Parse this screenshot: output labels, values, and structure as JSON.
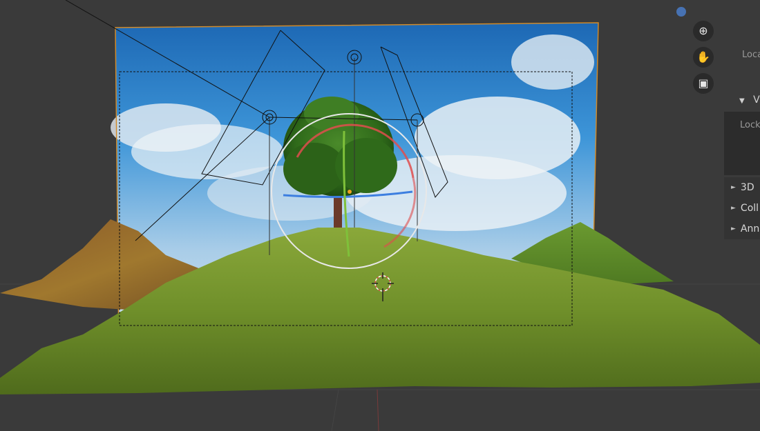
{
  "nav_gizmo": {
    "zoom_icon": "⊕",
    "pan_icon": "✋",
    "camera_icon": "▣"
  },
  "sidebar": {
    "location_label": "Loca",
    "view_panel_arrow": "▼",
    "view_panel_label": "V",
    "lock_label": "Lock",
    "collapsed_panels": [
      {
        "arrow": "►",
        "label": "3D"
      },
      {
        "arrow": "►",
        "label": "Coll"
      },
      {
        "arrow": "►",
        "label": "Ann"
      }
    ]
  },
  "colors": {
    "viewport_bg": "#3a3a3a",
    "sky_top": "#1d6fc0",
    "grass": "#6f8f2a",
    "selection_outline": "#d08a2a",
    "gizmo_x": "#e04d4d",
    "gizmo_y": "#7fc13a",
    "gizmo_z": "#3d7fe0",
    "accent": "#4772b3"
  }
}
